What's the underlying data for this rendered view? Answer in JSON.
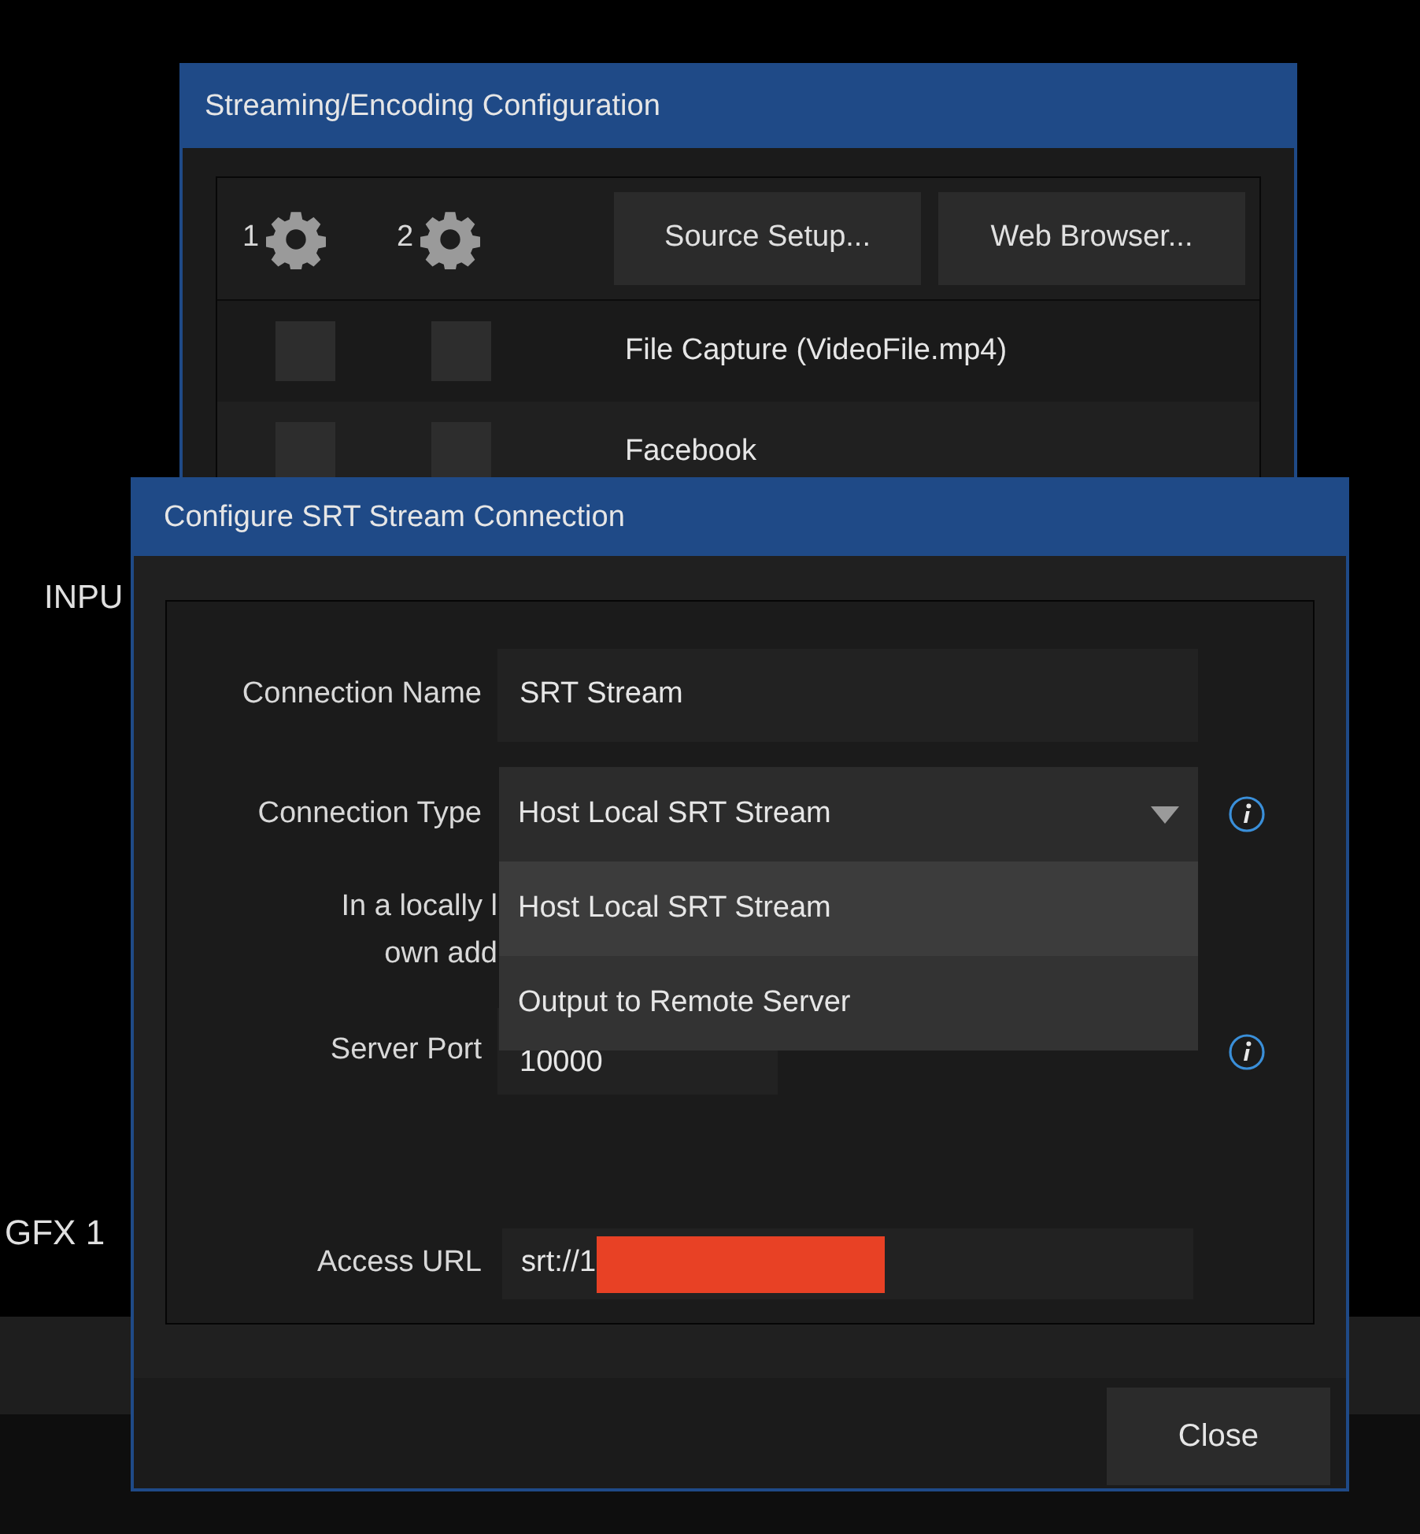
{
  "background": {
    "labels": [
      {
        "text": "INPU"
      },
      {
        "text": "GFX 1"
      }
    ]
  },
  "streaming_window": {
    "title": "Streaming/Encoding Configuration",
    "columns": [
      {
        "label": "1"
      },
      {
        "label": "2"
      }
    ],
    "buttons": [
      "Source Setup...",
      "Web Browser..."
    ],
    "rows": [
      {
        "name": "File Capture (VideoFile.mp4)",
        "checks": [
          {
            "checked": false
          },
          {
            "checked": false
          }
        ]
      },
      {
        "name": "Facebook",
        "checks": [
          {
            "checked": false
          },
          {
            "checked": false
          }
        ]
      }
    ]
  },
  "srt_dialog": {
    "title": "Configure SRT Stream Connection",
    "connection_name": {
      "label": "Connection Name",
      "value": "SRT Stream"
    },
    "connection_type": {
      "label": "Connection Type",
      "value": "Host Local SRT Stream",
      "expanded": true,
      "options": [
        {
          "label": "Host Local SRT Stream",
          "selected": true
        },
        {
          "label": "Output to Remote Server",
          "selected": false
        }
      ]
    },
    "hint_lines": [
      "In a locally l",
      "own add"
    ],
    "server_port": {
      "label": "Server Port",
      "value": "10000"
    },
    "access_url": {
      "label": "Access URL",
      "value": "srt://1",
      "redacted": true
    },
    "close_button": "Close"
  }
}
